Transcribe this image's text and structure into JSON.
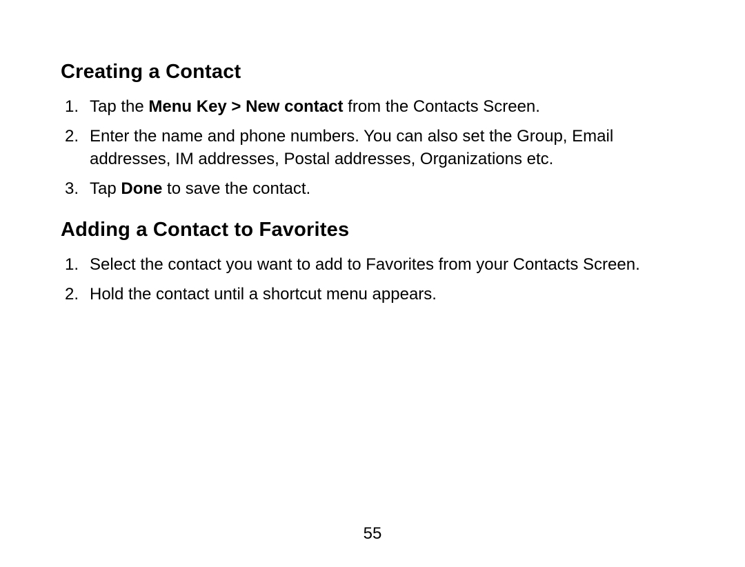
{
  "section1": {
    "heading": "Creating a Contact",
    "items": [
      {
        "prefix": "Tap the ",
        "bold": "Menu Key > New contact",
        "suffix": " from the Contacts Screen."
      },
      {
        "text": "Enter the name and phone numbers. You can also set the Group, Email addresses, IM addresses, Postal addresses, Organizations etc."
      },
      {
        "prefix": "Tap ",
        "bold": "Done",
        "suffix": " to save the contact."
      }
    ]
  },
  "section2": {
    "heading": "Adding a Contact to Favorites",
    "items": [
      {
        "text": "Select the contact you want to add to Favorites from your Contacts Screen."
      },
      {
        "text": "Hold the contact until a shortcut menu appears."
      }
    ]
  },
  "pageNumber": "55"
}
